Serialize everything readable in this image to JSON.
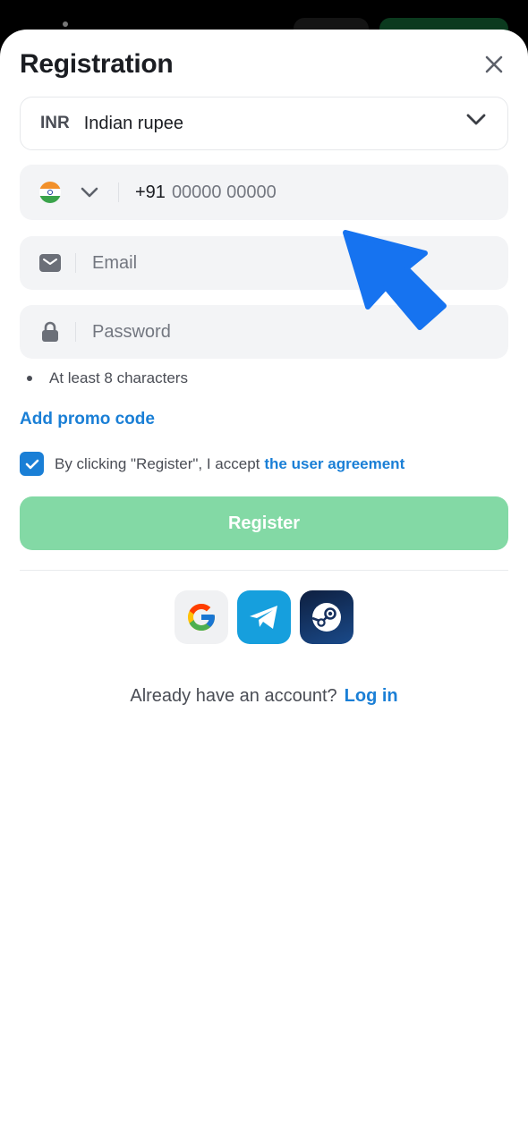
{
  "title": "Registration",
  "currency": {
    "code": "INR",
    "name": "Indian rupee"
  },
  "phone": {
    "prefix": "+91",
    "placeholder": "00000 00000",
    "flag": "india-flag"
  },
  "email": {
    "placeholder": "Email"
  },
  "password": {
    "placeholder": "Password"
  },
  "password_hint": "At least 8 characters",
  "promo_label": "Add promo code",
  "agreement": {
    "text": "By clicking \"Register\", I accept",
    "link": "the user agreement",
    "checked": true
  },
  "register_label": "Register",
  "social": [
    "google",
    "telegram",
    "steam"
  ],
  "login": {
    "question": "Already have an account?",
    "link": "Log in"
  },
  "colors": {
    "accent": "#1a7fd6",
    "register_bg": "#83d9a5",
    "cursor": "#1673f0"
  }
}
